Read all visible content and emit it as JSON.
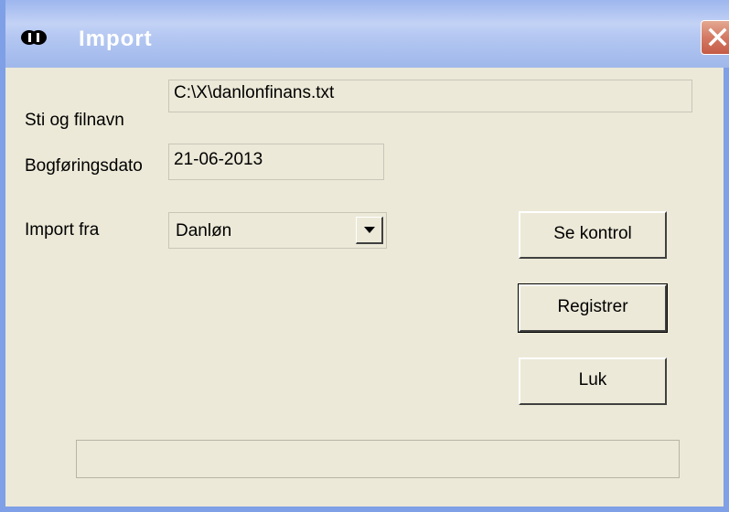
{
  "window": {
    "title": "Import",
    "title_color": "#ffffff",
    "titlebar_color": "#b4c7f2",
    "close_color": "#d47964"
  },
  "form": {
    "path_label": "Sti og filnavn",
    "path_value": "C:\\X\\danlonfinans.txt",
    "date_label": "Bogføringsdato",
    "date_value": "21-06-2013",
    "import_label": "Import fra",
    "import_value": "Danløn"
  },
  "buttons": {
    "control_label": "Se kontrol",
    "register_label": "Registrer",
    "close_label": "Luk"
  },
  "progress": {
    "value": 0
  }
}
